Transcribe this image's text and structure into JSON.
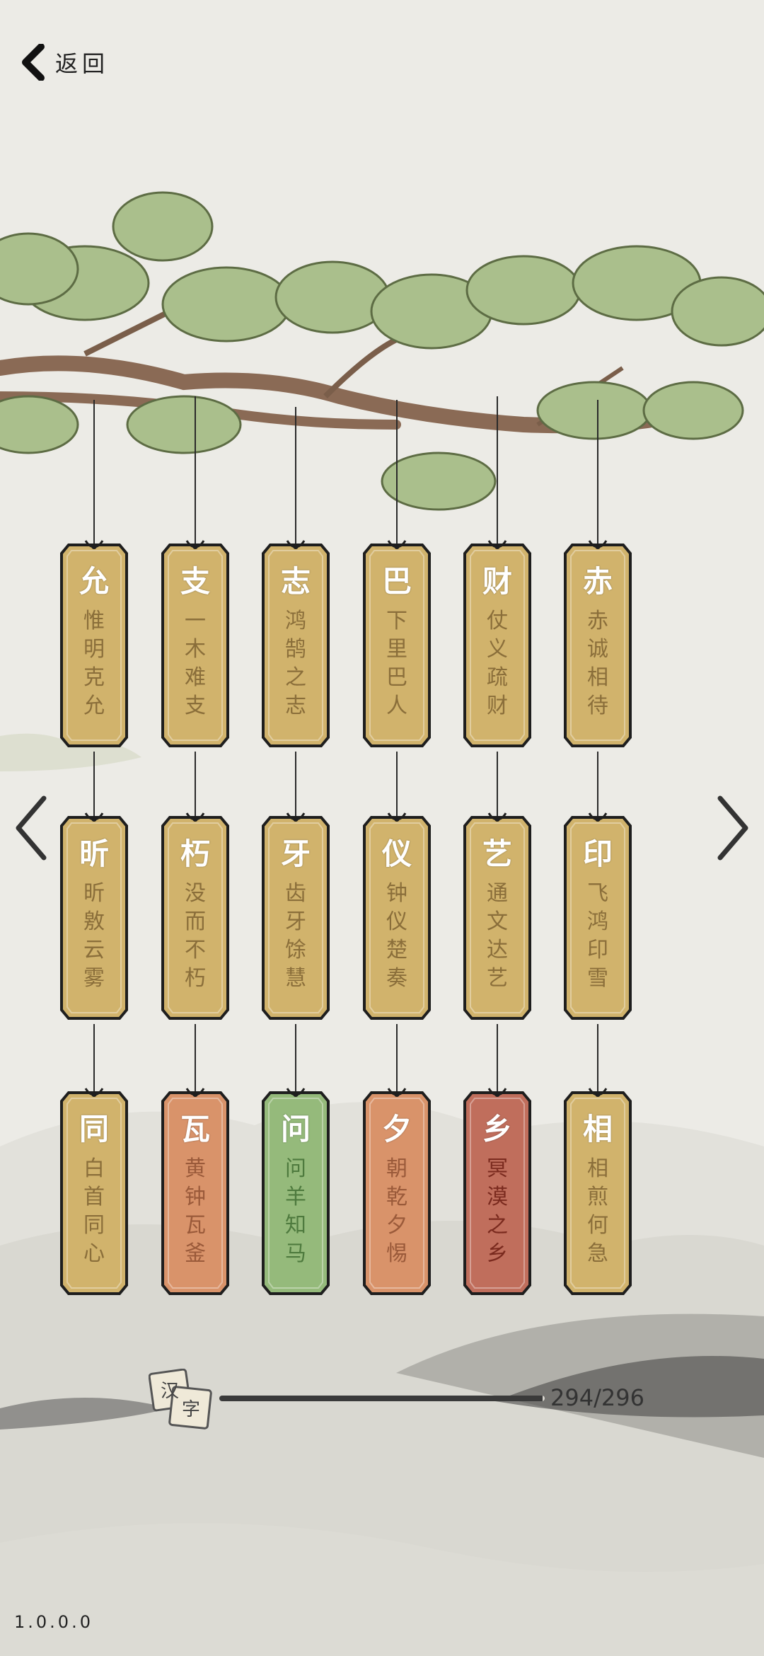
{
  "header": {
    "back_label": "返回"
  },
  "colors": {
    "gold": "#d1b36c",
    "orange": "#d9936a",
    "green": "#95ba7b",
    "red": "#c06e5c",
    "gold_text": "#8a6e3a",
    "orange_text": "#9a5a3a",
    "green_text": "#4e7a3e",
    "red_text": "#7a2a1e"
  },
  "cards": [
    {
      "char": "允",
      "idiom": "惟明克允",
      "color": "gold"
    },
    {
      "char": "支",
      "idiom": "一木难支",
      "color": "gold"
    },
    {
      "char": "志",
      "idiom": "鸿鹄之志",
      "color": "gold"
    },
    {
      "char": "巴",
      "idiom": "下里巴人",
      "color": "gold"
    },
    {
      "char": "财",
      "idiom": "仗义疏财",
      "color": "gold"
    },
    {
      "char": "赤",
      "idiom": "赤诚相待",
      "color": "gold"
    },
    {
      "char": "昕",
      "idiom": "昕敫云雾",
      "color": "gold"
    },
    {
      "char": "朽",
      "idiom": "没而不朽",
      "color": "gold"
    },
    {
      "char": "牙",
      "idiom": "齿牙馀慧",
      "color": "gold"
    },
    {
      "char": "仪",
      "idiom": "钟仪楚奏",
      "color": "gold"
    },
    {
      "char": "艺",
      "idiom": "通文达艺",
      "color": "gold"
    },
    {
      "char": "印",
      "idiom": "飞鸿印雪",
      "color": "gold"
    },
    {
      "char": "同",
      "idiom": "白首同心",
      "color": "gold"
    },
    {
      "char": "瓦",
      "idiom": "黄钟瓦釜",
      "color": "orange"
    },
    {
      "char": "问",
      "idiom": "问羊知马",
      "color": "green"
    },
    {
      "char": "夕",
      "idiom": "朝乾夕惕",
      "color": "orange"
    },
    {
      "char": "乡",
      "idiom": "冥漠之乡",
      "color": "red"
    },
    {
      "char": "相",
      "idiom": "相煎何急",
      "color": "gold"
    }
  ],
  "progress": {
    "icon_chars": [
      "汉",
      "字"
    ],
    "current": 294,
    "total": 296,
    "label": "294/296"
  },
  "version": "1.0.0.0"
}
